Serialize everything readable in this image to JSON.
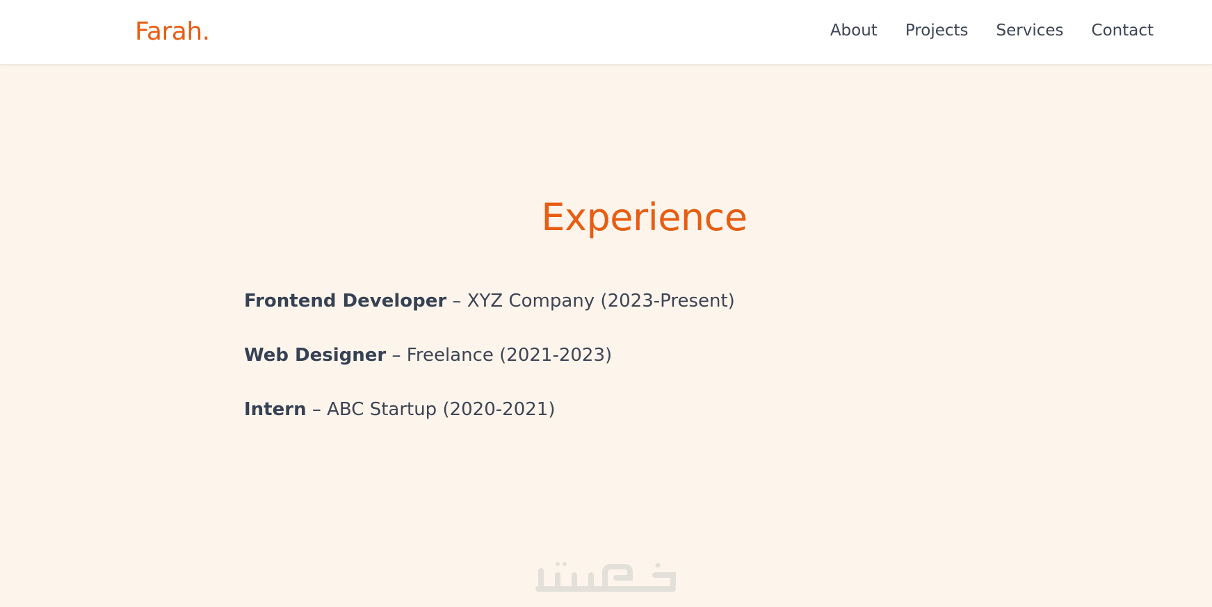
{
  "header": {
    "logo": "Farah.",
    "nav": [
      "About",
      "Projects",
      "Services",
      "Contact"
    ]
  },
  "experience": {
    "title": "Experience",
    "items": [
      {
        "role": "Frontend Developer",
        "detail": " – XYZ Company (2023-Present)"
      },
      {
        "role": "Web Designer",
        "detail": " – Freelance (2021-2023)"
      },
      {
        "role": "Intern",
        "detail": " – ABC Startup (2020-2021)"
      }
    ]
  },
  "watermark": {
    "text": "خمسات"
  },
  "colors": {
    "accent": "#e85d12",
    "background": "#fdf5ec",
    "text": "#3d4454"
  }
}
